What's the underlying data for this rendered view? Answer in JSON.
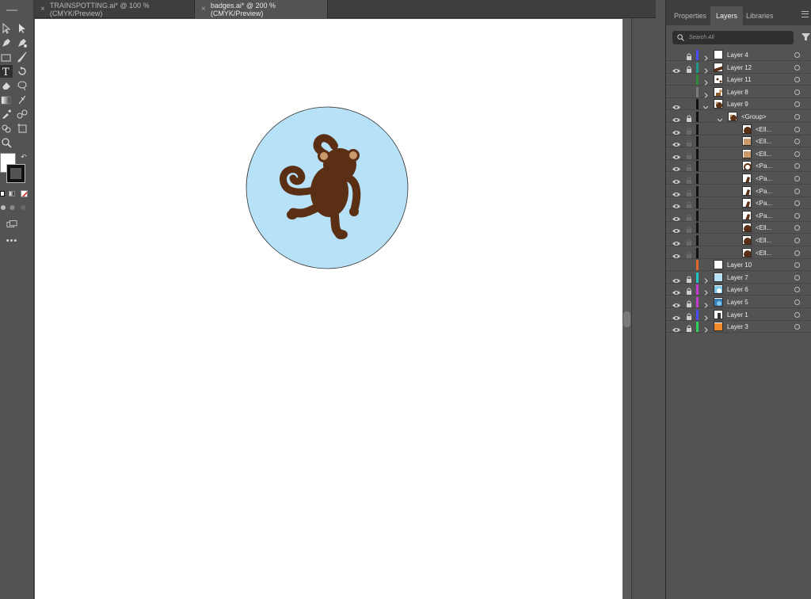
{
  "tabs": [
    {
      "label": "TRAINSPOTTING.ai* @ 100 % (CMYK/Preview)",
      "close": "×",
      "active": false
    },
    {
      "label": "badges.ai* @ 200 % (CMYK/Preview)",
      "close": "×",
      "active": true
    }
  ],
  "panel": {
    "tabs": [
      "Properties",
      "Layers",
      "Libraries"
    ],
    "active_tab": "Layers",
    "search_placeholder": "Search All"
  },
  "layers": [
    {
      "name": "Layer 4",
      "eye": false,
      "lock": true,
      "color": "#4a4aff",
      "indent": 0,
      "twisty": "closed",
      "thumb": "white"
    },
    {
      "name": "Layer 12",
      "eye": true,
      "lock": true,
      "color": "#1f9a8a",
      "indent": 0,
      "twisty": "closed",
      "thumb": "brownstripe"
    },
    {
      "name": "Layer 11",
      "eye": false,
      "lock": false,
      "color": "#2e8b3a",
      "indent": 0,
      "twisty": "closed",
      "thumb": "dots"
    },
    {
      "name": "Layer 8",
      "eye": false,
      "lock": false,
      "color": "#7a7a7a",
      "indent": 0,
      "twisty": "closed",
      "thumb": "figure"
    },
    {
      "name": "Layer 9",
      "eye": true,
      "lock": false,
      "color": "#111111",
      "indent": 0,
      "twisty": "open",
      "thumb": "monkey"
    },
    {
      "name": "<Group>",
      "eye": true,
      "lock": true,
      "color": "#111111",
      "indent": 1,
      "twisty": "open",
      "thumb": "monkey"
    },
    {
      "name": "<Ell...",
      "eye": true,
      "lock": false,
      "color": "#111111",
      "indent": 2,
      "twisty": "none",
      "thumb": "darkcircle"
    },
    {
      "name": "<Ell...",
      "eye": true,
      "lock": false,
      "color": "#111111",
      "indent": 2,
      "twisty": "none",
      "thumb": "tan"
    },
    {
      "name": "<Ell...",
      "eye": true,
      "lock": false,
      "color": "#111111",
      "indent": 2,
      "twisty": "none",
      "thumb": "tan"
    },
    {
      "name": "<Pa...",
      "eye": true,
      "lock": false,
      "color": "#111111",
      "indent": 2,
      "twisty": "none",
      "thumb": "swirl"
    },
    {
      "name": "<Pa...",
      "eye": true,
      "lock": false,
      "color": "#111111",
      "indent": 2,
      "twisty": "none",
      "thumb": "limb"
    },
    {
      "name": "<Pa...",
      "eye": true,
      "lock": false,
      "color": "#111111",
      "indent": 2,
      "twisty": "none",
      "thumb": "limb"
    },
    {
      "name": "<Pa...",
      "eye": true,
      "lock": false,
      "color": "#111111",
      "indent": 2,
      "twisty": "none",
      "thumb": "limb"
    },
    {
      "name": "<Pa...",
      "eye": true,
      "lock": false,
      "color": "#111111",
      "indent": 2,
      "twisty": "none",
      "thumb": "limb"
    },
    {
      "name": "<Ell...",
      "eye": true,
      "lock": false,
      "color": "#111111",
      "indent": 2,
      "twisty": "none",
      "thumb": "darkcircle"
    },
    {
      "name": "<Ell...",
      "eye": true,
      "lock": false,
      "color": "#111111",
      "indent": 2,
      "twisty": "none",
      "thumb": "darkcircle"
    },
    {
      "name": "<Ell...",
      "eye": true,
      "lock": false,
      "color": "#111111",
      "indent": 2,
      "twisty": "none",
      "thumb": "darkcircle"
    },
    {
      "name": "Layer 10",
      "eye": false,
      "lock": false,
      "color": "#e0662a",
      "indent": 0,
      "twisty": "none",
      "thumb": "white"
    },
    {
      "name": "Layer 7",
      "eye": true,
      "lock": true,
      "color": "#1fc4c4",
      "indent": 0,
      "twisty": "closed",
      "thumb": "lightblue"
    },
    {
      "name": "Layer 6",
      "eye": true,
      "lock": true,
      "color": "#c43bd1",
      "indent": 0,
      "twisty": "closed",
      "thumb": "bluebadge"
    },
    {
      "name": "Layer 5",
      "eye": true,
      "lock": true,
      "color": "#c43bd1",
      "indent": 0,
      "twisty": "closed",
      "thumb": "bluebadge2"
    },
    {
      "name": "Layer 1",
      "eye": true,
      "lock": true,
      "color": "#4a4aff",
      "indent": 0,
      "twisty": "closed",
      "thumb": "figure2"
    },
    {
      "name": "Layer 3",
      "eye": true,
      "lock": true,
      "color": "#2fd15a",
      "indent": 0,
      "twisty": "closed",
      "thumb": "orange"
    }
  ],
  "artwork": {
    "badge_color": "#b7e1f7",
    "monkey_color": "#5a2f14",
    "ear_color": "#c99a6c"
  },
  "colors": {
    "ui_dark": "#535353",
    "panel": "#4b4b4b",
    "tabbar": "#3e3e3e"
  }
}
